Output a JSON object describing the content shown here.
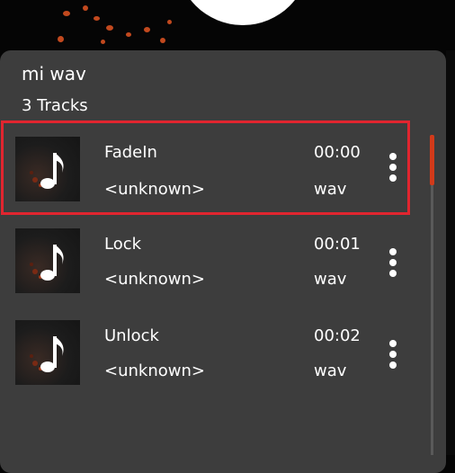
{
  "playlist": {
    "title": "mi wav",
    "track_count": "3 Tracks"
  },
  "tracks": [
    {
      "name": "FadeIn",
      "artist": "<unknown>",
      "duration": "00:00",
      "format": "wav",
      "selected": true
    },
    {
      "name": "Lock",
      "artist": "<unknown>",
      "duration": "00:01",
      "format": "wav",
      "selected": false
    },
    {
      "name": "Unlock",
      "artist": "<unknown>",
      "duration": "00:02",
      "format": "wav",
      "selected": false
    }
  ],
  "icons": {
    "thumbnail": "music-note-icon",
    "menu": "more-vert-icon"
  },
  "colors": {
    "panel": "#3d3d3d",
    "highlight": "#e1252f",
    "scroll_thumb": "#d23a1a",
    "text": "#ffffff"
  }
}
